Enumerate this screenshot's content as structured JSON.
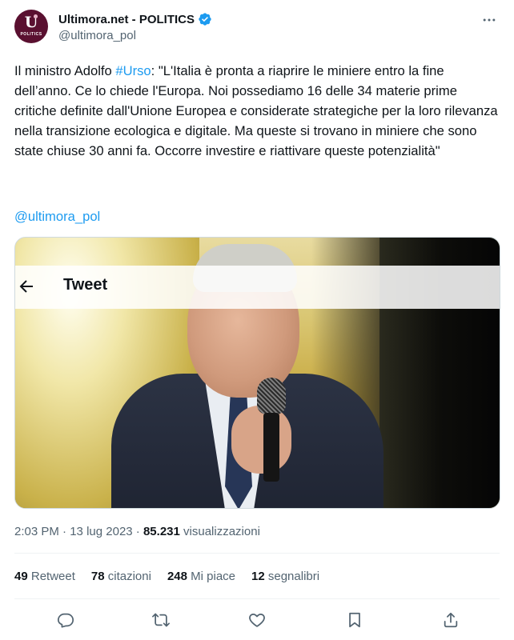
{
  "author": {
    "display_name": "Ultimora.net - POLITICS",
    "handle": "@ultimora_pol",
    "avatar_letter": "U",
    "avatar_text": "POLITICS",
    "verified_color": "#1d9bf0"
  },
  "tweet": {
    "text_before": "Il ministro Adolfo ",
    "hashtag": "#Urso",
    "text_after": ": \"L'Italia è pronta a riaprire le miniere entro la fine dell’anno. Ce lo chiede l'Europa. Noi possediamo 16 delle 34 materie prime critiche definite dall'Unione Europea e considerate strategiche per la loro rilevanza nella transizione ecologica e digitale. Ma queste si trovano in miniere che sono state chiuse 30 anni fa. Occorre investire e riattivare queste potenzialità\"",
    "mention": "@ultimora_pol"
  },
  "media": {
    "overlay_title": "Tweet"
  },
  "meta": {
    "time": "2:03 PM",
    "separator1": " · ",
    "date": "13 lug 2023",
    "separator2": " · ",
    "views_count": "85.231",
    "views_label": " visualizzazioni"
  },
  "stats": {
    "retweets": {
      "count": "49",
      "label": "Retweet"
    },
    "quotes": {
      "count": "78",
      "label": "citazioni"
    },
    "likes": {
      "count": "248",
      "label": "Mi piace"
    },
    "bookmarks": {
      "count": "12",
      "label": "segnalibri"
    }
  },
  "actions": [
    "reply-icon",
    "retweet-icon",
    "like-icon",
    "bookmark-icon",
    "share-icon"
  ],
  "colors": {
    "accent": "#1d9bf0",
    "text_primary": "#0f1419",
    "text_secondary": "#536471",
    "avatar_bg": "#5a1030"
  }
}
